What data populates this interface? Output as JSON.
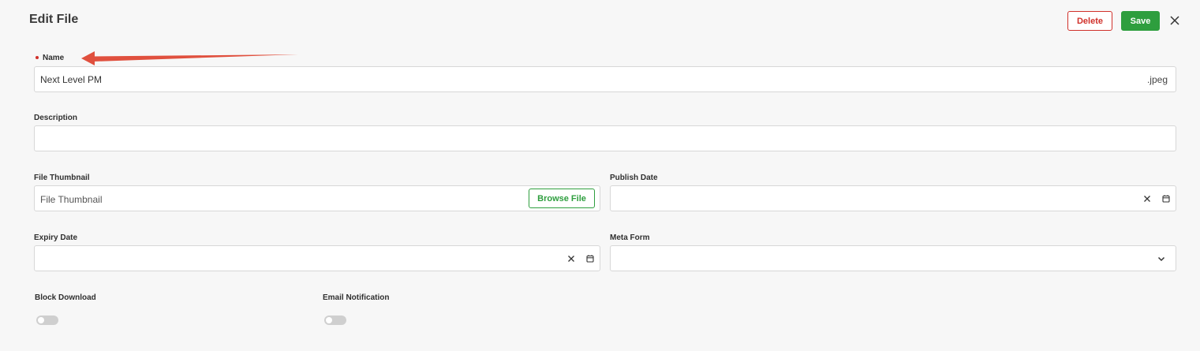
{
  "header": {
    "title": "Edit File",
    "delete_label": "Delete",
    "save_label": "Save"
  },
  "form": {
    "name": {
      "label": "Name",
      "value": "Next Level PM",
      "suffix": ".jpeg",
      "required": true
    },
    "description": {
      "label": "Description",
      "value": ""
    },
    "file_thumbnail": {
      "label": "File Thumbnail",
      "placeholder": "File Thumbnail",
      "browse_label": "Browse File"
    },
    "publish_date": {
      "label": "Publish Date",
      "value": ""
    },
    "expiry_date": {
      "label": "Expiry Date",
      "value": ""
    },
    "meta_form": {
      "label": "Meta Form",
      "value": ""
    },
    "block_download": {
      "label": "Block Download",
      "enabled": false
    },
    "email_notification": {
      "label": "Email Notification",
      "enabled": false
    }
  },
  "colors": {
    "danger": "#d0302a",
    "success": "#2e9e3e",
    "annotation_arrow": "#e0503e"
  },
  "icons": {
    "close": "close-icon",
    "calendar": "calendar-icon",
    "clear": "clear-icon",
    "dropdown": "chevron-down-icon"
  }
}
